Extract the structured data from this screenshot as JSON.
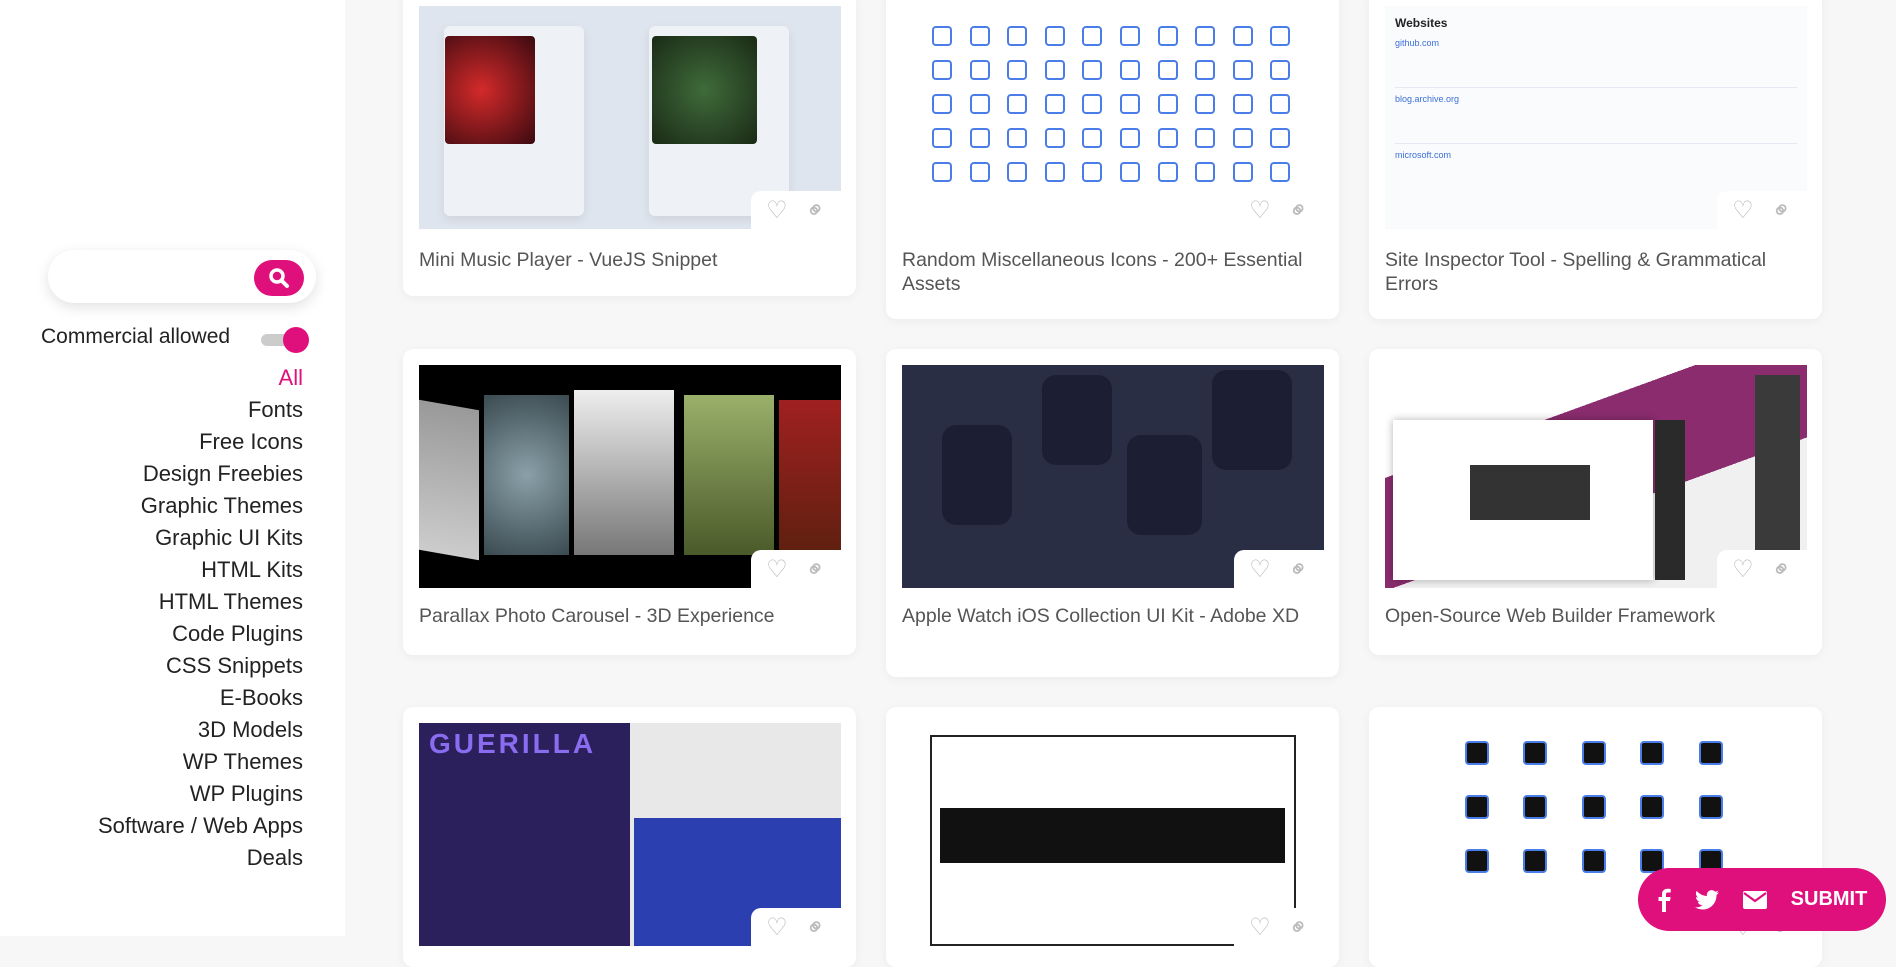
{
  "search": {
    "placeholder": "",
    "icon": "search-icon"
  },
  "filter": {
    "commercial_label": "Commercial allowed",
    "commercial_on": true
  },
  "categories": [
    "All",
    "Fonts",
    "Free Icons",
    "Design Freebies",
    "Graphic Themes",
    "Graphic UI Kits",
    "HTML Kits",
    "HTML Themes",
    "Code Plugins",
    "CSS Snippets",
    "E-Books",
    "3D Models",
    "WP Themes",
    "WP Plugins",
    "Software / Web Apps",
    "Deals"
  ],
  "active_category": "All",
  "cards": [
    {
      "title": "Mini Music Player - VueJS Snippet"
    },
    {
      "title": "Random Miscellaneous Icons - 200+ Essential Assets"
    },
    {
      "title": "Site Inspector Tool - Spelling & Grammatical Errors"
    },
    {
      "title": "Parallax Photo Carousel - 3D Experience"
    },
    {
      "title": "Apple Watch iOS Collection UI Kit - Adobe XD"
    },
    {
      "title": "Open-Source Web Builder Framework"
    },
    {
      "title": ""
    },
    {
      "title": ""
    },
    {
      "title": ""
    }
  ],
  "submit": {
    "label": "SUBMIT",
    "icons": [
      "facebook-icon",
      "twitter-icon",
      "mail-icon"
    ]
  },
  "colors": {
    "accent": "#df0f7b"
  }
}
